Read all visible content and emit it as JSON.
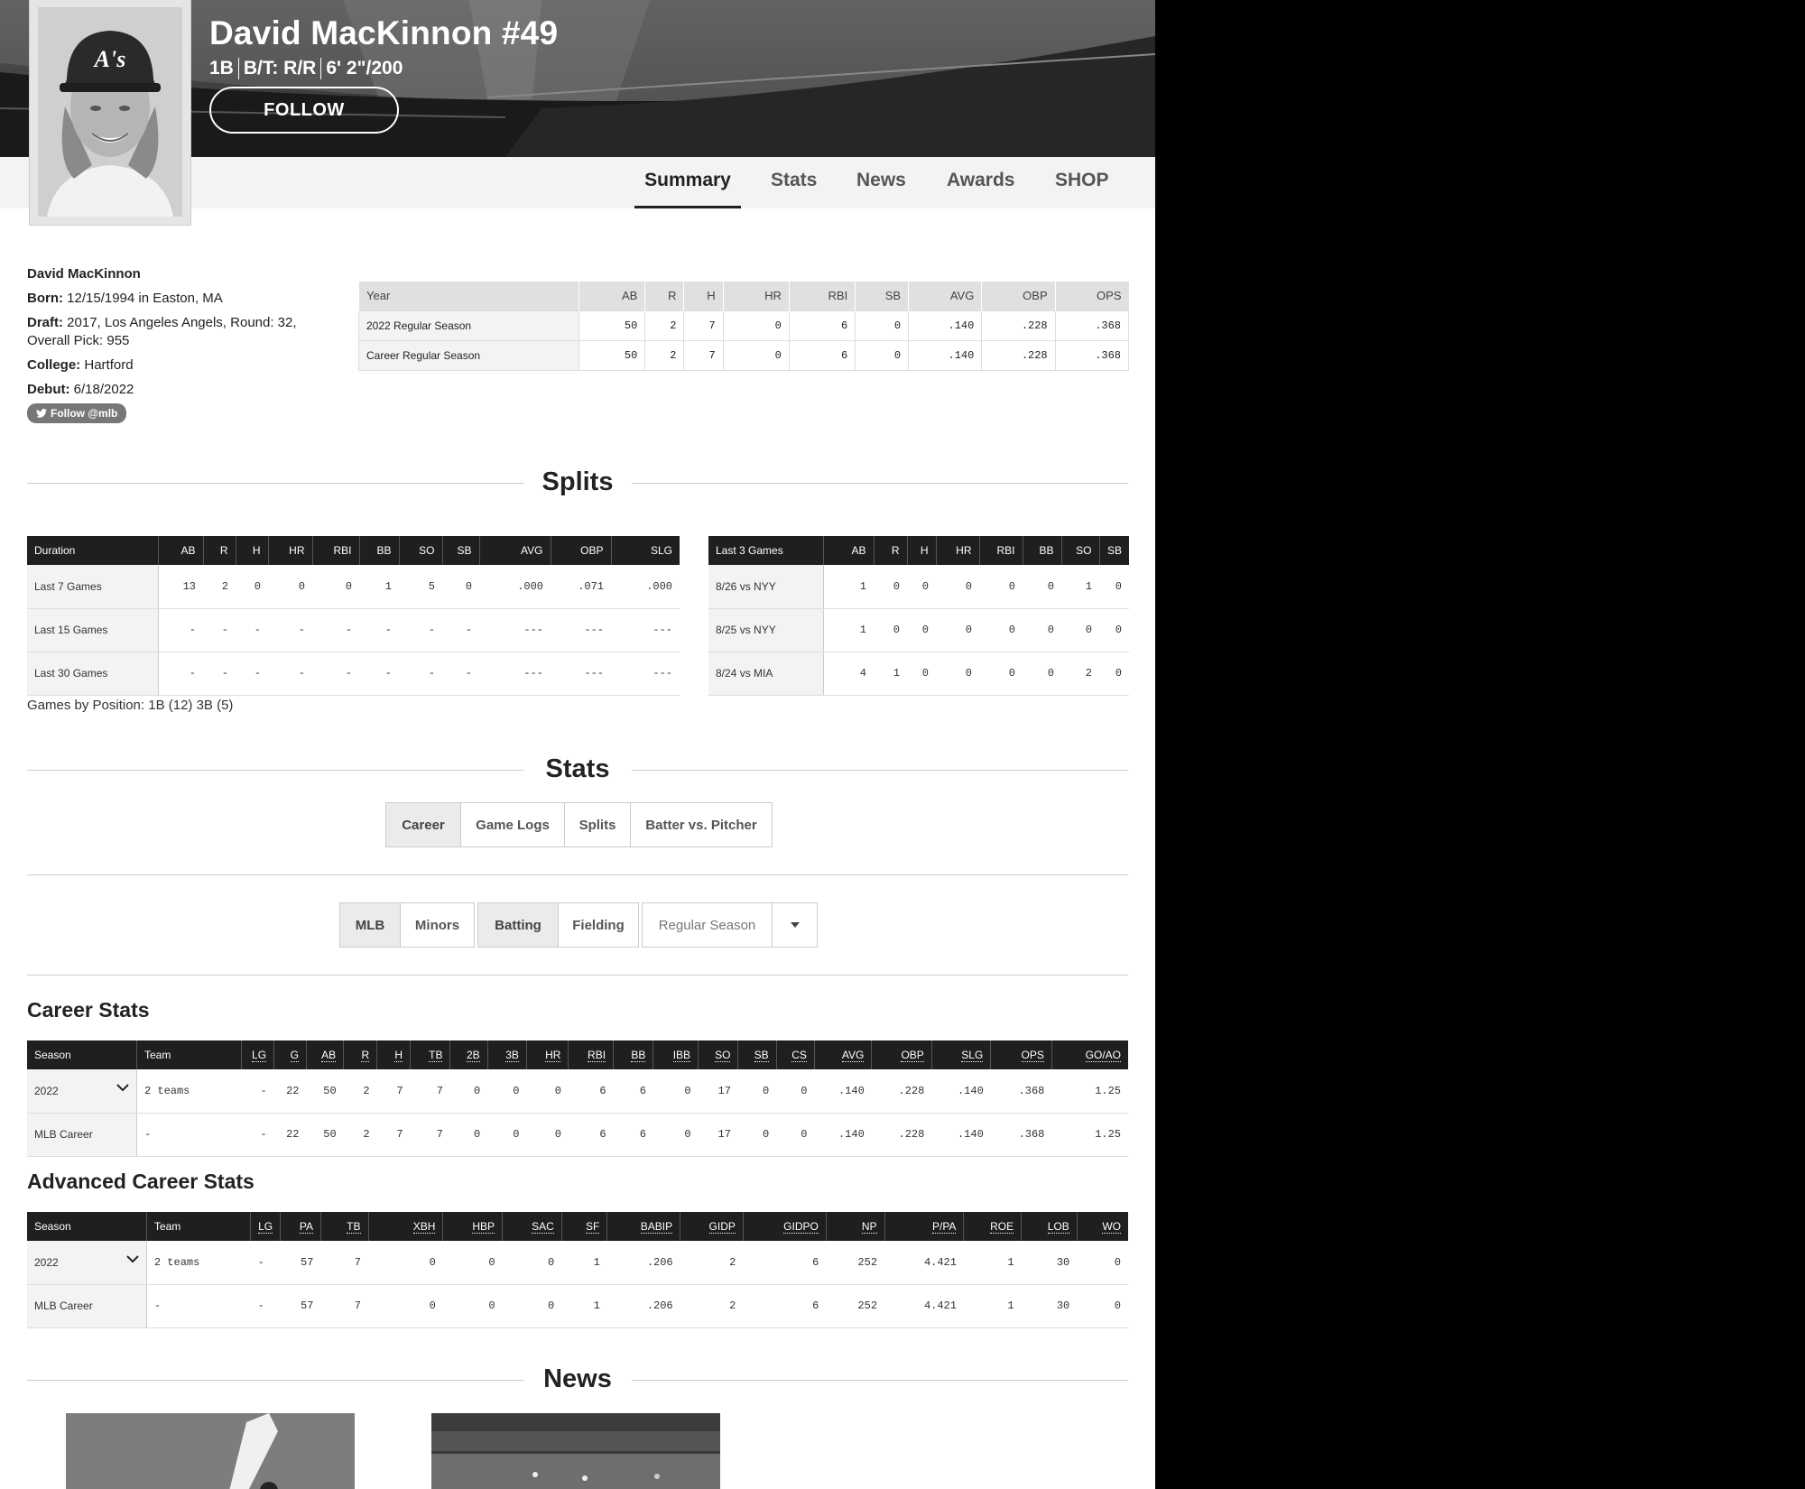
{
  "player": {
    "name": "David MacKinnon #49",
    "position": "1B",
    "bats_throws": "B/T: R/R",
    "height_weight": "6' 2\"/200",
    "follow_label": "FOLLOW"
  },
  "nav": {
    "tabs": [
      "Summary",
      "Stats",
      "News",
      "Awards",
      "SHOP"
    ],
    "active": "Summary"
  },
  "bio": {
    "full_name": "David MacKinnon",
    "born_label": "Born:",
    "born": "12/15/1994 in Easton, MA",
    "draft_label": "Draft:",
    "draft": "2017, Los Angeles Angels, Round: 32, Overall Pick: 955",
    "college_label": "College:",
    "college": "Hartford",
    "debut_label": "Debut:",
    "debut": "6/18/2022",
    "twitter": "Follow @mlb"
  },
  "summary_table": {
    "headers": [
      "Year",
      "AB",
      "R",
      "H",
      "HR",
      "RBI",
      "SB",
      "AVG",
      "OBP",
      "OPS"
    ],
    "rows": [
      [
        "2022 Regular Season",
        "50",
        "2",
        "7",
        "0",
        "6",
        "0",
        ".140",
        ".228",
        ".368"
      ],
      [
        "Career Regular Season",
        "50",
        "2",
        "7",
        "0",
        "6",
        "0",
        ".140",
        ".228",
        ".368"
      ]
    ]
  },
  "splits": {
    "title": "Splits",
    "duration_headers": [
      "Duration",
      "AB",
      "R",
      "H",
      "HR",
      "RBI",
      "BB",
      "SO",
      "SB",
      "AVG",
      "OBP",
      "SLG"
    ],
    "duration_rows": [
      [
        "Last 7 Games",
        "13",
        "2",
        "0",
        "0",
        "0",
        "1",
        "5",
        "0",
        ".000",
        ".071",
        ".000"
      ],
      [
        "Last 15 Games",
        "-",
        "-",
        "-",
        "-",
        "-",
        "-",
        "-",
        "-",
        "---",
        "---",
        "---"
      ],
      [
        "Last 30 Games",
        "-",
        "-",
        "-",
        "-",
        "-",
        "-",
        "-",
        "-",
        "---",
        "---",
        "---"
      ]
    ],
    "games_headers": [
      "Last 3 Games",
      "AB",
      "R",
      "H",
      "HR",
      "RBI",
      "BB",
      "SO",
      "SB"
    ],
    "games_rows": [
      [
        "8/26 vs NYY",
        "1",
        "0",
        "0",
        "0",
        "0",
        "0",
        "1",
        "0"
      ],
      [
        "8/25 vs NYY",
        "1",
        "0",
        "0",
        "0",
        "0",
        "0",
        "0",
        "0"
      ],
      [
        "8/24 vs MIA",
        "4",
        "1",
        "0",
        "0",
        "0",
        "0",
        "2",
        "0"
      ]
    ],
    "games_by_position": "Games by Position: 1B (12) 3B (5)"
  },
  "stats": {
    "title": "Stats",
    "view_tabs": [
      "Career",
      "Game Logs",
      "Splits",
      "Batter vs. Pitcher"
    ],
    "view_selected": "Career",
    "league_tabs": [
      "MLB",
      "Minors"
    ],
    "league_selected": "MLB",
    "type_tabs": [
      "Batting",
      "Fielding"
    ],
    "type_selected": "Batting",
    "season_select": "Regular Season"
  },
  "career": {
    "title": "Career Stats",
    "headers": [
      "Season",
      "Team",
      "LG",
      "G",
      "AB",
      "R",
      "H",
      "TB",
      "2B",
      "3B",
      "HR",
      "RBI",
      "BB",
      "IBB",
      "SO",
      "SB",
      "CS",
      "AVG",
      "OBP",
      "SLG",
      "OPS",
      "GO/AO"
    ],
    "rows": [
      [
        "2022",
        "2 teams",
        "-",
        "22",
        "50",
        "2",
        "7",
        "7",
        "0",
        "0",
        "0",
        "6",
        "6",
        "0",
        "17",
        "0",
        "0",
        ".140",
        ".228",
        ".140",
        ".368",
        "1.25"
      ],
      [
        "MLB Career",
        "-",
        "-",
        "22",
        "50",
        "2",
        "7",
        "7",
        "0",
        "0",
        "0",
        "6",
        "6",
        "0",
        "17",
        "0",
        "0",
        ".140",
        ".228",
        ".140",
        ".368",
        "1.25"
      ]
    ]
  },
  "advanced": {
    "title": "Advanced Career Stats",
    "headers": [
      "Season",
      "Team",
      "LG",
      "PA",
      "TB",
      "XBH",
      "HBP",
      "SAC",
      "SF",
      "BABIP",
      "GIDP",
      "GIDPO",
      "NP",
      "P/PA",
      "ROE",
      "LOB",
      "WO"
    ],
    "rows": [
      [
        "2022",
        "2 teams",
        "-",
        "57",
        "7",
        "0",
        "0",
        "0",
        "1",
        ".206",
        "2",
        "6",
        "252",
        "4.421",
        "1",
        "30",
        "0"
      ],
      [
        "MLB Career",
        "-",
        "-",
        "57",
        "7",
        "0",
        "0",
        "0",
        "1",
        ".206",
        "2",
        "6",
        "252",
        "4.421",
        "1",
        "30",
        "0"
      ]
    ]
  },
  "news": {
    "title": "News"
  },
  "icons": {
    "twitter": "twitter-bird-icon",
    "row_expand": "chevron-down-icon",
    "select_caret": "caret-down-icon"
  }
}
